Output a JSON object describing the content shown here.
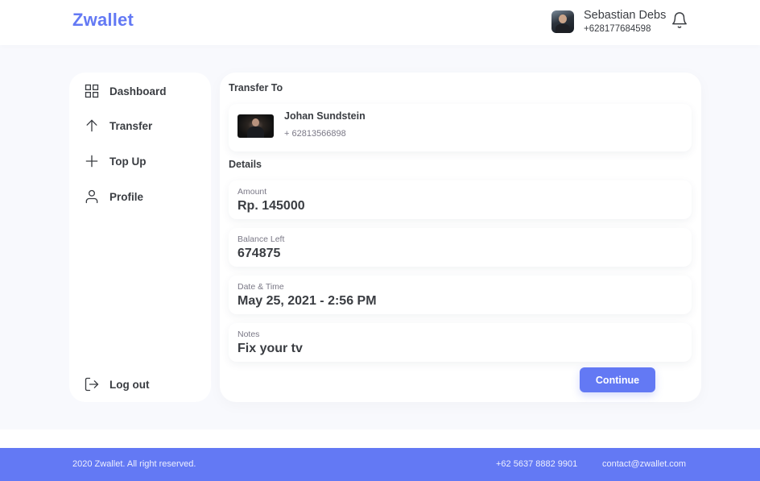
{
  "header": {
    "brand": "Zwallet",
    "user_name": "Sebastian Debs",
    "user_phone": "+628177684598",
    "avatar_icon": "user-avatar",
    "bell_icon": "bell-icon"
  },
  "sidebar": {
    "items": [
      {
        "label": "Dashboard",
        "icon": "grid-icon"
      },
      {
        "label": "Transfer",
        "icon": "arrow-up-icon"
      },
      {
        "label": "Top Up",
        "icon": "plus-icon"
      },
      {
        "label": "Profile",
        "icon": "user-icon"
      }
    ],
    "logout": {
      "label": "Log out",
      "icon": "logout-icon"
    }
  },
  "main": {
    "transfer_title": "Transfer To",
    "recipient": {
      "name": "Johan Sundstein",
      "phone": "+ 62813566898"
    },
    "details_title": "Details",
    "details": [
      {
        "label": "Amount",
        "value": "Rp. 145000"
      },
      {
        "label": "Balance Left",
        "value": "674875"
      },
      {
        "label": "Date & Time",
        "value": "May 25, 2021 - 2:56 PM"
      },
      {
        "label": "Notes",
        "value": "Fix your tv"
      }
    ],
    "continue_label": "Continue"
  },
  "footer": {
    "copyright": "2020 Zwallet. All right reserved.",
    "phone": "+62 5637 8882 9901",
    "email": "contact@zwallet.com"
  },
  "colors": {
    "accent": "#6379f4",
    "text": "#3a3d42",
    "muted": "#7a7886",
    "background": "#f8f9fd"
  }
}
